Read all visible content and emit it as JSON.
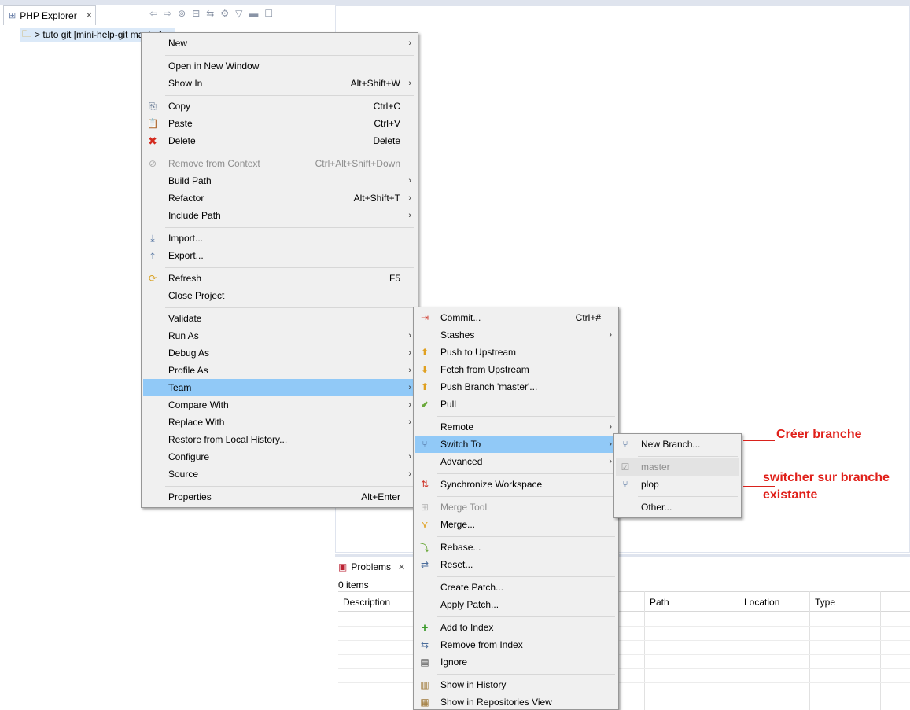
{
  "explorer": {
    "tab_label": "PHP Explorer",
    "project_label": "> tuto git  [mini-help-git master]"
  },
  "problems": {
    "tab_label": "Problems",
    "count": "0 items",
    "columns": [
      "Description",
      "Path",
      "Location",
      "Type"
    ]
  },
  "context_menu": {
    "items": [
      {
        "label": "New",
        "submenu": true
      },
      {
        "label": "Open in New Window"
      },
      {
        "label": "Show In",
        "shortcut": "Alt+Shift+W",
        "submenu": true
      },
      {
        "label": "Copy",
        "shortcut": "Ctrl+C",
        "icon": "copy-icon"
      },
      {
        "label": "Paste",
        "shortcut": "Ctrl+V",
        "icon": "paste-icon"
      },
      {
        "label": "Delete",
        "shortcut": "Delete",
        "icon": "delete-icon"
      },
      {
        "label": "Remove from Context",
        "shortcut": "Ctrl+Alt+Shift+Down",
        "disabled": true
      },
      {
        "label": "Build Path",
        "submenu": true
      },
      {
        "label": "Refactor",
        "shortcut": "Alt+Shift+T",
        "submenu": true
      },
      {
        "label": "Include Path",
        "submenu": true
      },
      {
        "label": "Import...",
        "icon": "import-icon"
      },
      {
        "label": "Export...",
        "icon": "export-icon"
      },
      {
        "label": "Refresh",
        "shortcut": "F5",
        "icon": "refresh-icon"
      },
      {
        "label": "Close Project"
      },
      {
        "label": "Validate"
      },
      {
        "label": "Run As",
        "submenu": true
      },
      {
        "label": "Debug As",
        "submenu": true
      },
      {
        "label": "Profile As",
        "submenu": true
      },
      {
        "label": "Team",
        "submenu": true,
        "highlighted": true
      },
      {
        "label": "Compare With",
        "submenu": true
      },
      {
        "label": "Replace With",
        "submenu": true
      },
      {
        "label": "Restore from Local History..."
      },
      {
        "label": "Configure",
        "submenu": true
      },
      {
        "label": "Source",
        "submenu": true
      },
      {
        "label": "Properties",
        "shortcut": "Alt+Enter"
      }
    ]
  },
  "team_menu": {
    "items": [
      {
        "label": "Commit...",
        "shortcut": "Ctrl+#"
      },
      {
        "label": "Stashes",
        "submenu": true
      },
      {
        "label": "Push to Upstream"
      },
      {
        "label": "Fetch from Upstream"
      },
      {
        "label": "Push Branch 'master'..."
      },
      {
        "label": "Pull"
      },
      {
        "label": "Remote",
        "submenu": true
      },
      {
        "label": "Switch To",
        "submenu": true,
        "highlighted": true
      },
      {
        "label": "Advanced",
        "submenu": true
      },
      {
        "label": "Synchronize Workspace"
      },
      {
        "label": "Merge Tool",
        "disabled": true
      },
      {
        "label": "Merge..."
      },
      {
        "label": "Rebase..."
      },
      {
        "label": "Reset..."
      },
      {
        "label": "Create Patch..."
      },
      {
        "label": "Apply Patch..."
      },
      {
        "label": "Add to Index"
      },
      {
        "label": "Remove from Index"
      },
      {
        "label": "Ignore"
      },
      {
        "label": "Show in History"
      },
      {
        "label": "Show in Repositories View"
      }
    ]
  },
  "switch_menu": {
    "items": [
      {
        "label": "New Branch..."
      },
      {
        "label": "master",
        "disabled": true
      },
      {
        "label": "plop"
      },
      {
        "label": "Other..."
      }
    ]
  },
  "annotations": {
    "create_branch": "Créer branche",
    "switch_line1": "switcher sur branche",
    "switch_line2": "existante"
  },
  "colors": {
    "highlight": "#91c9f7",
    "menu_bg": "#f0f0f0",
    "annotation": "#e0201a"
  }
}
